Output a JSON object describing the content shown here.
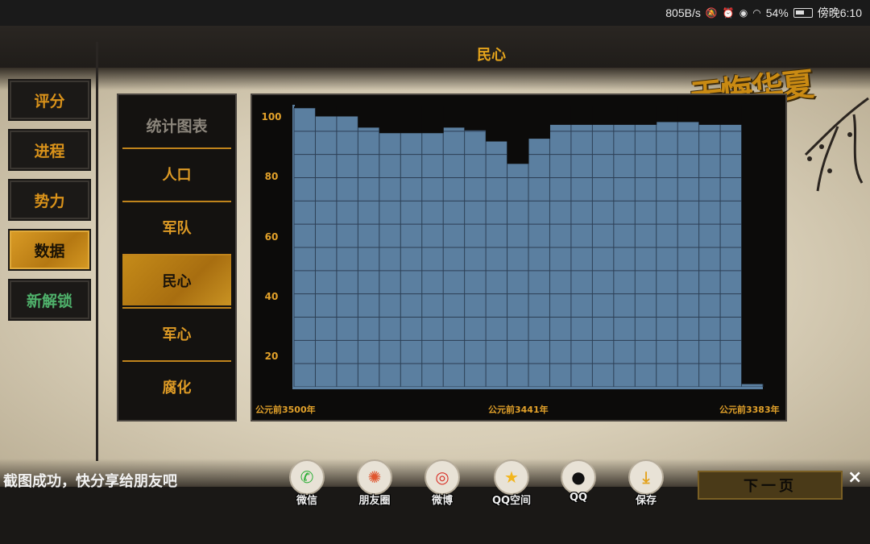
{
  "status_bar": {
    "speed": "805B/s",
    "battery": "54%",
    "time": "傍晚6:10"
  },
  "screen_title": "民心",
  "logo_text": "无悔华夏",
  "side_menu": [
    {
      "label": "评分",
      "active": false
    },
    {
      "label": "进程",
      "active": false
    },
    {
      "label": "势力",
      "active": false
    },
    {
      "label": "数据",
      "active": true
    },
    {
      "label": "新解锁",
      "active": false
    }
  ],
  "category_panel": {
    "title": "统计图表",
    "items": [
      {
        "label": "人口",
        "active": false
      },
      {
        "label": "军队",
        "active": false
      },
      {
        "label": "民心",
        "active": true
      },
      {
        "label": "军心",
        "active": false
      },
      {
        "label": "腐化",
        "active": false
      }
    ]
  },
  "chart_data": {
    "type": "bar",
    "ylim": [
      0,
      100
    ],
    "yticks": [
      "100",
      "80",
      "60",
      "40",
      "20"
    ],
    "x_labels": [
      "公元前3500年",
      "公元前3441年",
      "公元前3383年"
    ],
    "values": [
      100,
      97,
      97,
      93,
      91,
      91,
      91,
      93,
      92,
      88,
      80,
      89,
      94,
      94,
      94,
      94,
      94,
      95,
      95,
      94,
      94,
      1
    ],
    "grid": true,
    "colors": {
      "bar": "#5b7fa0",
      "grid": "#2c3f55",
      "background": "#0c0b0a",
      "text": "#e2a12a"
    }
  },
  "share_bar": {
    "message": "截图成功，快分享给朋友吧",
    "items": [
      {
        "label": "微信",
        "icon": "wechat-icon"
      },
      {
        "label": "朋友圈",
        "icon": "moments-icon"
      },
      {
        "label": "微博",
        "icon": "weibo-icon"
      },
      {
        "label": "QQ空间",
        "icon": "qzone-icon"
      },
      {
        "label": "QQ",
        "icon": "qq-icon"
      },
      {
        "label": "保存",
        "icon": "download-icon"
      }
    ],
    "close_label": "×"
  },
  "next_button": "下一页"
}
